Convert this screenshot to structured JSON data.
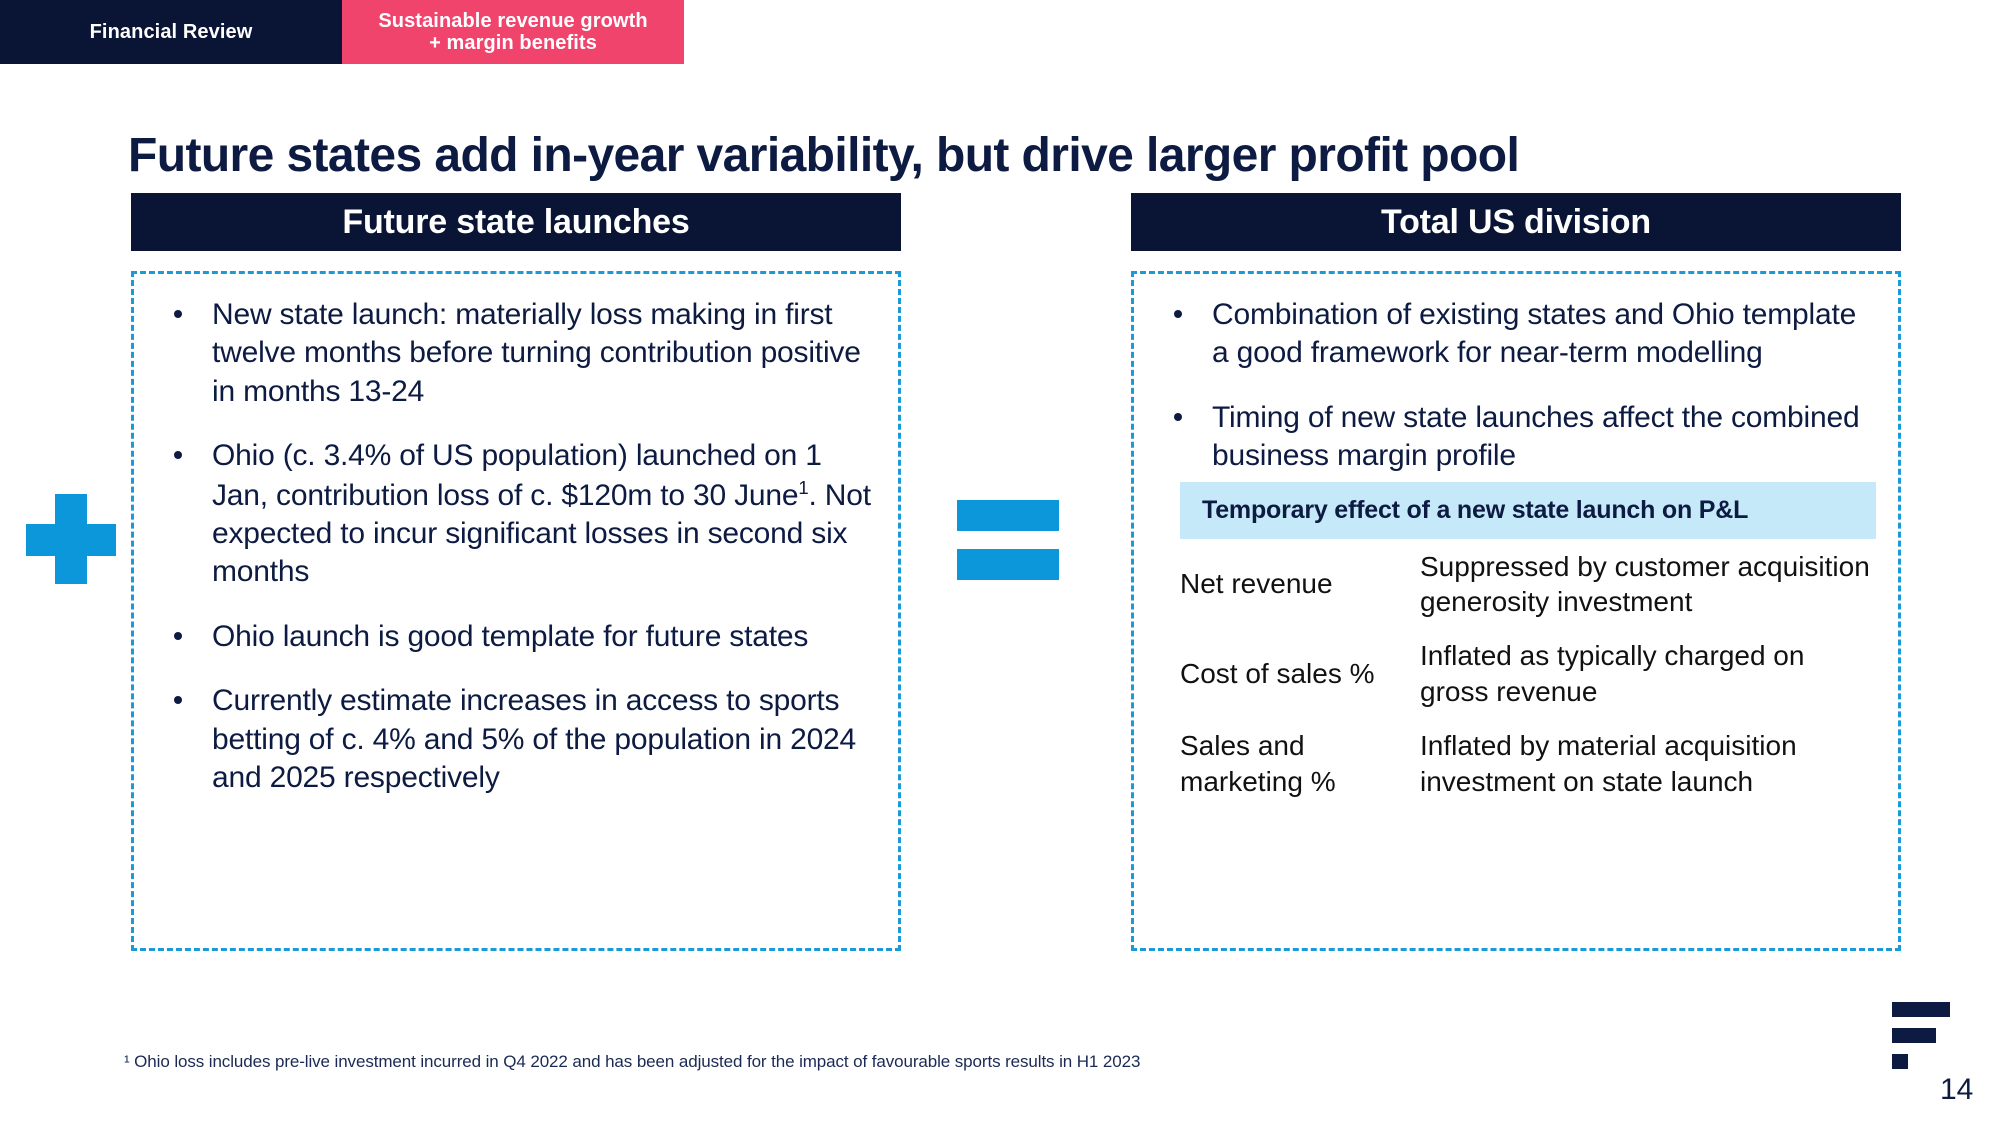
{
  "ribbon": {
    "left_label": "Financial Review",
    "right_label_line1": "Sustainable revenue growth",
    "right_label_line2": "+ margin benefits"
  },
  "title": "Future states add in-year variability, but drive larger profit pool",
  "operators": {
    "plus": "plus-symbol",
    "equals": "equals-symbol",
    "color": "#0d97db"
  },
  "left_panel": {
    "header": "Future state launches",
    "bullets": [
      "New state launch: materially loss making in first twelve months before turning contribution positive in months 13-24",
      "Ohio (c. 3.4% of US population) launched on 1 Jan, contribution loss of c. $120m to 30 June¹. Not expected to incur significant losses in second six months",
      "Ohio launch is good template for future states",
      "Currently estimate increases in access to sports betting of c. 4% and 5% of the population in 2024 and 2025 respectively"
    ],
    "bullet_2_pre": "Ohio (c. 3.4% of US population) launched on 1 Jan, contribution loss of c. $120m to 30 June",
    "bullet_2_sup": "1",
    "bullet_2_post": ". Not expected to incur significant losses in second six months"
  },
  "right_panel": {
    "header": "Total US division",
    "bullets": [
      "Combination of existing states and Ohio template a good framework for near-term modelling",
      "Timing of new state launches affect the combined business margin profile"
    ],
    "effect_band": "Temporary effect of a new state launch on P&L",
    "effect_band_color": "#c5e9f8",
    "effect_rows": [
      {
        "label": "Net revenue",
        "description": "Suppressed by customer acquisition generosity investment"
      },
      {
        "label": "Cost of sales %",
        "description": "Inflated as typically charged on gross revenue"
      },
      {
        "label": "Sales and marketing %",
        "description": "Inflated by material acquisition investment on state launch"
      }
    ]
  },
  "footnote": "¹ Ohio loss includes pre-live investment incurred in Q4 2022 and has been adjusted for the impact of favourable sports results in H1 2023",
  "page_number": "14",
  "colors": {
    "navy": "#0a1535",
    "pink": "#f0446d",
    "blue": "#1a9bd7",
    "text_navy": "#0d1b42"
  }
}
